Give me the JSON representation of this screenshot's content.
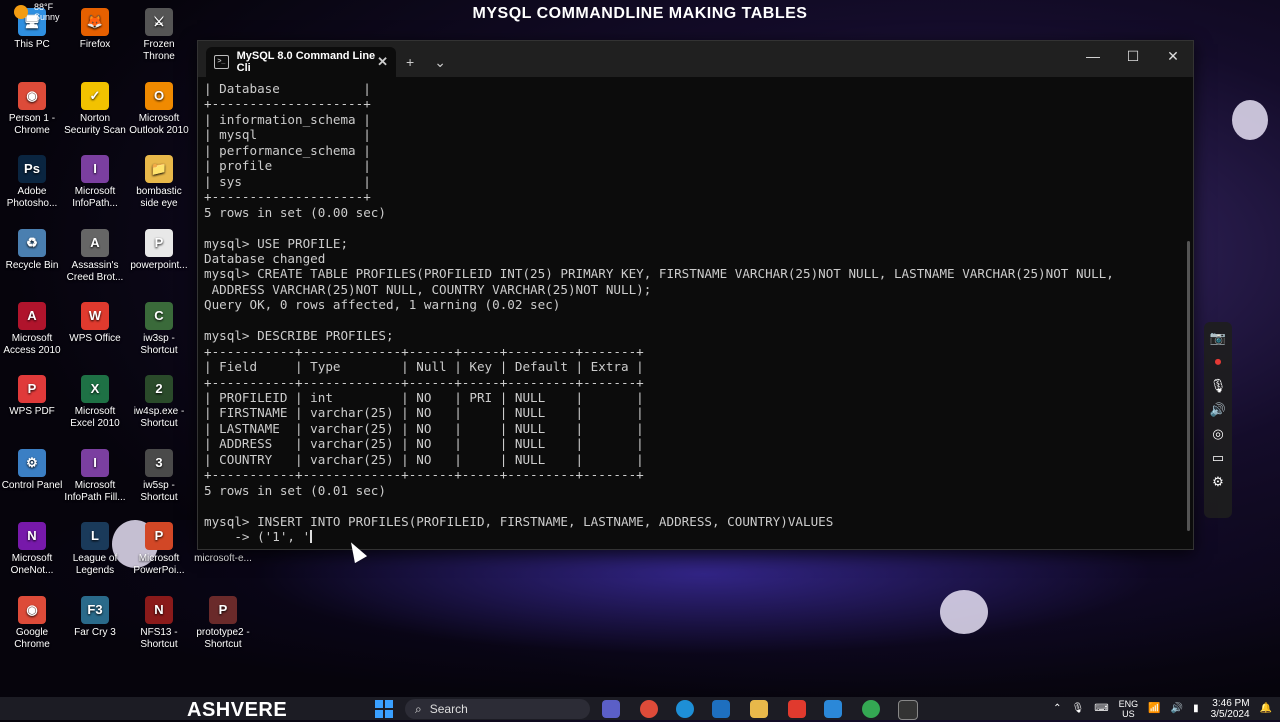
{
  "overlay_title": "MYSQL COMMANDLINE MAKING TABLES",
  "watermark": "ASHVERE",
  "desktop_icons": [
    {
      "label": "This PC",
      "icon": "monitor-icon",
      "color": "#2f8fe0",
      "glyph": "🖥"
    },
    {
      "label": "Firefox",
      "icon": "firefox-icon",
      "color": "#e66000",
      "glyph": "🦊"
    },
    {
      "label": "Frozen Throne",
      "icon": "game-icon",
      "color": "#555555",
      "glyph": "⚔"
    },
    {
      "label": "Person 1 - Chrome",
      "icon": "chrome-icon",
      "color": "#dd4b39",
      "glyph": "◉"
    },
    {
      "label": "Norton Security Scan",
      "icon": "norton-icon",
      "color": "#f2c200",
      "glyph": "✓"
    },
    {
      "label": "Microsoft Outlook 2010",
      "icon": "outlook-icon",
      "color": "#f08a00",
      "glyph": "O"
    },
    {
      "label": "Adobe Photosho...",
      "icon": "photoshop-icon",
      "color": "#0a2540",
      "glyph": "Ps"
    },
    {
      "label": "Microsoft InfoPath...",
      "icon": "infopath-icon",
      "color": "#7b3fa0",
      "glyph": "I"
    },
    {
      "label": "bombastic side eye",
      "icon": "folder-icon",
      "color": "#e8b84a",
      "glyph": "📁"
    },
    {
      "label": "Recycle Bin",
      "icon": "recycle-bin-icon",
      "color": "#4a7fb0",
      "glyph": "♻"
    },
    {
      "label": "Assassin's Creed Brot...",
      "icon": "game-icon",
      "color": "#666666",
      "glyph": "A"
    },
    {
      "label": "powerpoint...",
      "icon": "document-icon",
      "color": "#e8e8e8",
      "glyph": "P"
    },
    {
      "label": "Microsoft Access 2010",
      "icon": "access-icon",
      "color": "#b0142c",
      "glyph": "A"
    },
    {
      "label": "WPS Office",
      "icon": "wps-icon",
      "color": "#e03a2e",
      "glyph": "W"
    },
    {
      "label": "iw3sp - Shortcut",
      "icon": "game-icon",
      "color": "#3a6a3a",
      "glyph": "C"
    },
    {
      "label": "WPS PDF",
      "icon": "pdf-icon",
      "color": "#e03a3a",
      "glyph": "P"
    },
    {
      "label": "Microsoft Excel 2010",
      "icon": "excel-icon",
      "color": "#1e7145",
      "glyph": "X"
    },
    {
      "label": "iw4sp.exe - Shortcut",
      "icon": "game-icon",
      "color": "#2a4a2a",
      "glyph": "2"
    },
    {
      "label": "Control Panel",
      "icon": "control-panel-icon",
      "color": "#3b7fc4",
      "glyph": "⚙"
    },
    {
      "label": "Microsoft InfoPath Fill...",
      "icon": "infopath-icon",
      "color": "#7b3fa0",
      "glyph": "I"
    },
    {
      "label": "iw5sp - Shortcut",
      "icon": "game-icon",
      "color": "#4a4a4a",
      "glyph": "3"
    },
    {
      "label": "Microsoft OneNot...",
      "icon": "onenote-icon",
      "color": "#7719aa",
      "glyph": "N"
    },
    {
      "label": "League of Legends",
      "icon": "game-icon",
      "color": "#1a3a5a",
      "glyph": "L"
    },
    {
      "label": "Microsoft PowerPoi...",
      "icon": "powerpoint-icon",
      "color": "#d24726",
      "glyph": "P"
    },
    {
      "label": "microsoft-e...",
      "icon": "edge-icon",
      "color": "#1e6fbf",
      "glyph": "e"
    },
    {
      "label": "Google Chrome",
      "icon": "chrome-icon",
      "color": "#dd4b39",
      "glyph": "◉"
    },
    {
      "label": "Far Cry 3",
      "icon": "game-icon",
      "color": "#2a6a8a",
      "glyph": "F3"
    },
    {
      "label": "NFS13 - Shortcut",
      "icon": "game-icon",
      "color": "#8a1a1a",
      "glyph": "N"
    },
    {
      "label": "prototype2 - Shortcut",
      "icon": "game-icon",
      "color": "#6a2a2a",
      "glyph": "P"
    }
  ],
  "terminal": {
    "tab_title": "MySQL 8.0 Command Line Cli",
    "new_tab_label": "+",
    "dropdown_label": "⌄",
    "console_lines": [
      "| Database           |",
      "+--------------------+",
      "| information_schema |",
      "| mysql              |",
      "| performance_schema |",
      "| profile            |",
      "| sys                |",
      "+--------------------+",
      "5 rows in set (0.00 sec)",
      "",
      "mysql> USE PROFILE;",
      "Database changed",
      "mysql> CREATE TABLE PROFILES(PROFILEID INT(25) PRIMARY KEY, FIRSTNAME VARCHAR(25)NOT NULL, LASTNAME VARCHAR(25)NOT NULL,",
      " ADDRESS VARCHAR(25)NOT NULL, COUNTRY VARCHAR(25)NOT NULL);",
      "Query OK, 0 rows affected, 1 warning (0.02 sec)",
      "",
      "mysql> DESCRIBE PROFILES;",
      "+-----------+-------------+------+-----+---------+-------+",
      "| Field     | Type        | Null | Key | Default | Extra |",
      "+-----------+-------------+------+-----+---------+-------+",
      "| PROFILEID | int         | NO   | PRI | NULL    |       |",
      "| FIRSTNAME | varchar(25) | NO   |     | NULL    |       |",
      "| LASTNAME  | varchar(25) | NO   |     | NULL    |       |",
      "| ADDRESS   | varchar(25) | NO   |     | NULL    |       |",
      "| COUNTRY   | varchar(25) | NO   |     | NULL    |       |",
      "+-----------+-------------+------+-----+---------+-------+",
      "5 rows in set (0.01 sec)",
      "",
      "mysql> INSERT INTO PROFILES(PROFILEID, FIRSTNAME, LASTNAME, ADDRESS, COUNTRY)VALUES"
    ],
    "current_input": "    -> ('1', '"
  },
  "side_toolbar": [
    {
      "name": "camera-icon",
      "glyph": "📷"
    },
    {
      "name": "record-icon",
      "glyph": "⏺"
    },
    {
      "name": "microphone-icon",
      "glyph": "🎙"
    },
    {
      "name": "speaker-icon",
      "glyph": "🔊"
    },
    {
      "name": "webcam-icon",
      "glyph": "◎"
    },
    {
      "name": "window-icon",
      "glyph": "▭"
    },
    {
      "name": "settings-icon",
      "glyph": "⚙"
    }
  ],
  "taskbar": {
    "weather_temp": "88°F",
    "weather_text": "Sunny",
    "search_label": "Search",
    "lang_top": "ENG",
    "lang_bottom": "US",
    "time": "3:46 PM",
    "date": "3/5/2024"
  }
}
